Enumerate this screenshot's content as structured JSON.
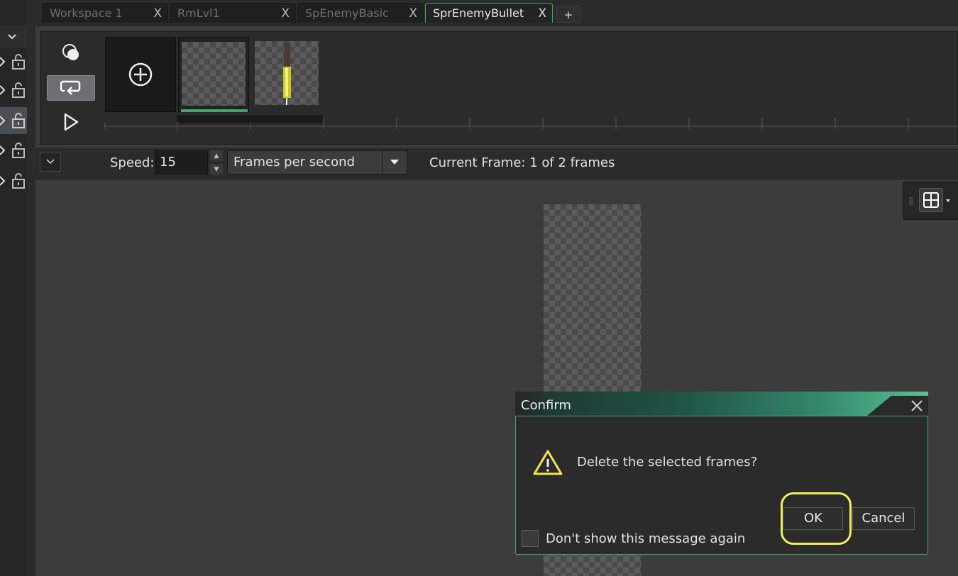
{
  "tabs": [
    {
      "label": "Workspace 1",
      "active": false
    },
    {
      "label": "RmLvl1",
      "active": false
    },
    {
      "label": "SpEnemyBasic",
      "active": false
    },
    {
      "label": "SprEnemyBullet",
      "active": true
    }
  ],
  "tab_add_label": "+",
  "tab_close_glyph": "X",
  "frames_panel": {
    "frame_count": 2,
    "selected_frame": 1,
    "icons": [
      "onion-skin-icon",
      "loop-icon",
      "play-icon",
      "add-frame-icon"
    ]
  },
  "speed_bar": {
    "speed_label": "Speed:",
    "speed_value": "15",
    "fps_mode": "Frames per second",
    "current_frame_text": "Current Frame: 1 of 2 frames"
  },
  "dialog": {
    "title": "Confirm",
    "message": "Delete the selected frames?",
    "ok_label": "OK",
    "cancel_label": "Cancel",
    "dont_show_label": "Don't show this message again"
  },
  "colors": {
    "accent_green": "#3fa66a",
    "highlight_yellow": "#f0f05a",
    "panel_bg": "#2b2b2b",
    "canvas_bg": "#3c3c3c"
  }
}
